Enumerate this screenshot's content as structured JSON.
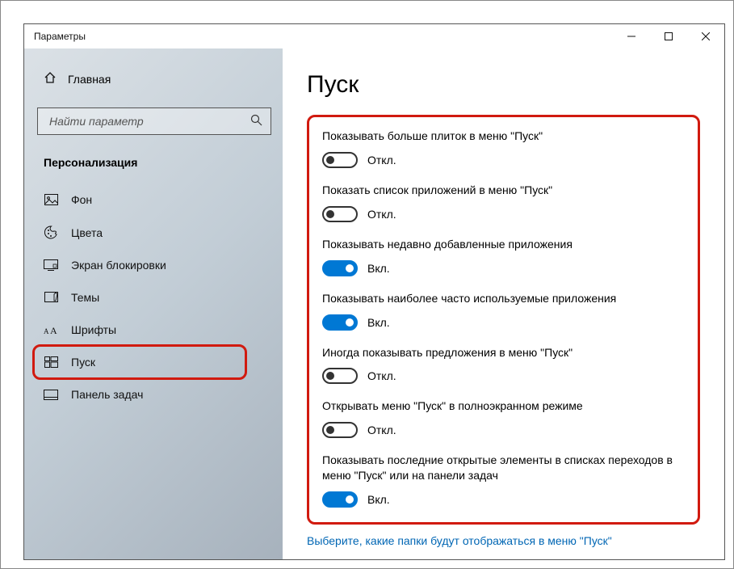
{
  "titlebar": {
    "title": "Параметры"
  },
  "sidebar": {
    "home": "Главная",
    "search_placeholder": "Найти параметр",
    "category": "Персонализация",
    "items": [
      {
        "label": "Фон"
      },
      {
        "label": "Цвета"
      },
      {
        "label": "Экран блокировки"
      },
      {
        "label": "Темы"
      },
      {
        "label": "Шрифты"
      },
      {
        "label": "Пуск"
      },
      {
        "label": "Панель задач"
      }
    ]
  },
  "page": {
    "title": "Пуск",
    "state_on": "Вкл.",
    "state_off": "Откл.",
    "settings": [
      {
        "label": "Показывать больше плиток в меню \"Пуск\"",
        "on": false
      },
      {
        "label": "Показать список приложений в меню \"Пуск\"",
        "on": false
      },
      {
        "label": "Показывать недавно добавленные приложения",
        "on": true
      },
      {
        "label": "Показывать наиболее часто используемые приложения",
        "on": true
      },
      {
        "label": "Иногда показывать предложения в меню \"Пуск\"",
        "on": false
      },
      {
        "label": "Открывать меню \"Пуск\" в полноэкранном режиме",
        "on": false
      },
      {
        "label": "Показывать последние открытые элементы в списках переходов в меню \"Пуск\" или на панели задач",
        "on": true
      }
    ],
    "link": "Выберите, какие папки будут отображаться в меню \"Пуск\""
  }
}
